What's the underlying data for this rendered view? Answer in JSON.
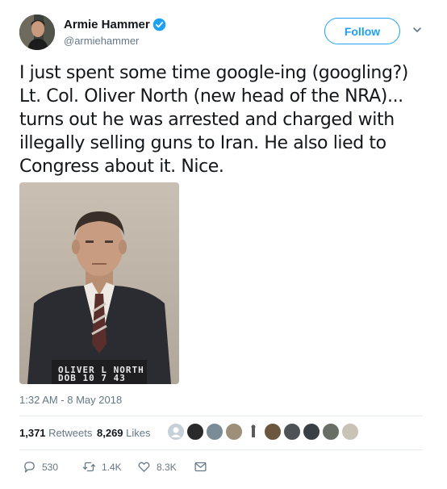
{
  "user": {
    "display_name": "Armie Hammer",
    "handle": "@armiehammer",
    "verified_icon": "verified-badge-icon",
    "follow_label": "Follow"
  },
  "tweet": {
    "text": "I just spent some time google-ing (googling?) Lt. Col. Oliver North (new head of the NRA)... turns out he was arrested and charged with illegally selling guns to Iran. He also lied to Congress about it. Nice.",
    "photo_caption_line1": "OLIVER L NORTH",
    "photo_caption_line2": "DOB 10 7 43",
    "timestamp": "1:32 AM - 8 May 2018"
  },
  "stats": {
    "retweets_count": "1,371",
    "retweets_label": "Retweets",
    "likes_count": "8,269",
    "likes_label": "Likes"
  },
  "actions": {
    "reply_count": "530",
    "retweet_count": "1.4K",
    "like_count": "8.3K"
  },
  "colors": {
    "accent": "#1da1f2",
    "secondary_text": "#657786",
    "divider": "#e6ecf0"
  }
}
